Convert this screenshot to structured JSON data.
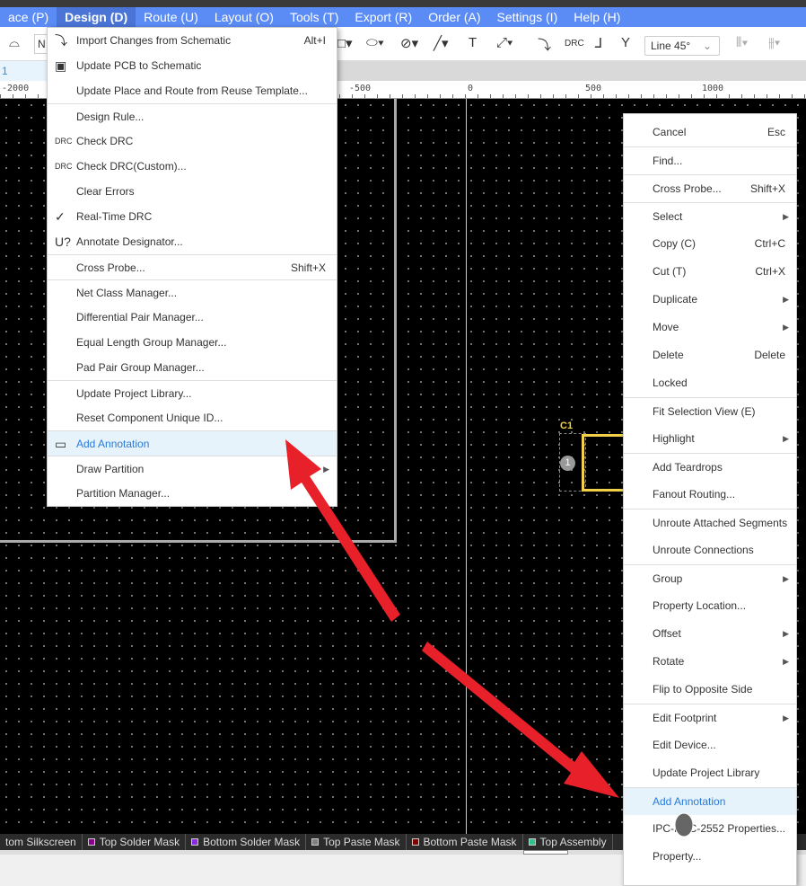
{
  "menubar": [
    "ace (P)",
    "Design (D)",
    "Route (U)",
    "Layout (O)",
    "Tools (T)",
    "Export (R)",
    "Order (A)",
    "Settings (I)",
    "Help (H)"
  ],
  "toolbar": {
    "line_mode": "Line 45°",
    "drc": "DRC",
    "partial_input": "N"
  },
  "tab": "1",
  "ruler": [
    "-2000",
    "-500",
    "0",
    "500",
    "1000"
  ],
  "design_menu": [
    {
      "label": "Import Changes from Schematic",
      "shortcut": "Alt+I",
      "icon": "import-icon"
    },
    {
      "label": "Update PCB to Schematic",
      "icon": "update-schematic-icon"
    },
    {
      "label": "Update Place and Route from Reuse Template..."
    },
    {
      "label": "Design Rule...",
      "sep": true
    },
    {
      "label": "Check DRC",
      "icon": "drc-icon"
    },
    {
      "label": "Check DRC(Custom)...",
      "icon": "drc-icon"
    },
    {
      "label": "Clear Errors"
    },
    {
      "label": "Real-Time DRC",
      "icon": "check-icon"
    },
    {
      "label": "Annotate Designator...",
      "icon": "annotate-designator-icon"
    },
    {
      "label": "Cross Probe...",
      "shortcut": "Shift+X",
      "sep": true
    },
    {
      "label": "Net Class Manager...",
      "sep": true
    },
    {
      "label": "Differential Pair Manager..."
    },
    {
      "label": "Equal Length Group Manager..."
    },
    {
      "label": "Pad Pair Group Manager..."
    },
    {
      "label": "Update Project Library...",
      "sep": true
    },
    {
      "label": "Reset Component Unique ID..."
    },
    {
      "label": "Add Annotation",
      "sep": true,
      "highlight": true,
      "icon": "annotation-icon"
    },
    {
      "label": "Draw Partition",
      "sep": true,
      "submenu": true
    },
    {
      "label": "Partition Manager..."
    }
  ],
  "context_menu": [
    {
      "label": "Cancel",
      "shortcut": "Esc"
    },
    {
      "label": "Find...",
      "sep": true
    },
    {
      "label": "Cross Probe...",
      "shortcut": "Shift+X",
      "sep": true
    },
    {
      "label": "Select",
      "submenu": true,
      "sep": true
    },
    {
      "label": "Copy (C)",
      "shortcut": "Ctrl+C"
    },
    {
      "label": "Cut (T)",
      "shortcut": "Ctrl+X"
    },
    {
      "label": "Duplicate",
      "submenu": true
    },
    {
      "label": "Move",
      "submenu": true
    },
    {
      "label": "Delete",
      "shortcut": "Delete"
    },
    {
      "label": "Locked"
    },
    {
      "label": "Fit Selection View (E)",
      "sep": true
    },
    {
      "label": "Highlight",
      "submenu": true
    },
    {
      "label": "Add Teardrops",
      "sep": true
    },
    {
      "label": "Fanout Routing..."
    },
    {
      "label": "Unroute Attached Segments",
      "sep": true
    },
    {
      "label": "Unroute Connections"
    },
    {
      "label": "Group",
      "submenu": true,
      "sep": true
    },
    {
      "label": "Property Location..."
    },
    {
      "label": "Offset",
      "submenu": true
    },
    {
      "label": "Rotate",
      "submenu": true
    },
    {
      "label": "Flip to Opposite Side"
    },
    {
      "label": "Edit Footprint",
      "submenu": true,
      "sep": true
    },
    {
      "label": "Edit Device..."
    },
    {
      "label": "Update Project Library"
    },
    {
      "label": "Add Annotation",
      "sep": true,
      "highlight": true
    },
    {
      "label": "IPC-NAC-2552 Properties..."
    },
    {
      "label": "Property..."
    }
  ],
  "component": {
    "designator": "C1",
    "pad": "1"
  },
  "layers": [
    {
      "label": "tom Silkscreen"
    },
    {
      "label": "Top Solder Mask",
      "color": "#8b008b"
    },
    {
      "label": "Bottom Solder Mask",
      "color": "#8a2be2"
    },
    {
      "label": "Top Paste Mask",
      "color": "#808080"
    },
    {
      "label": "Bottom Paste Mask",
      "color": "#800000"
    },
    {
      "label": "Top Assembly",
      "color": "#33c28a"
    }
  ],
  "colors": {
    "menubar": "#5b8cf6",
    "highlight": "#e6f3fb",
    "arrow": "#e8202a",
    "component": "#f2d14a"
  }
}
